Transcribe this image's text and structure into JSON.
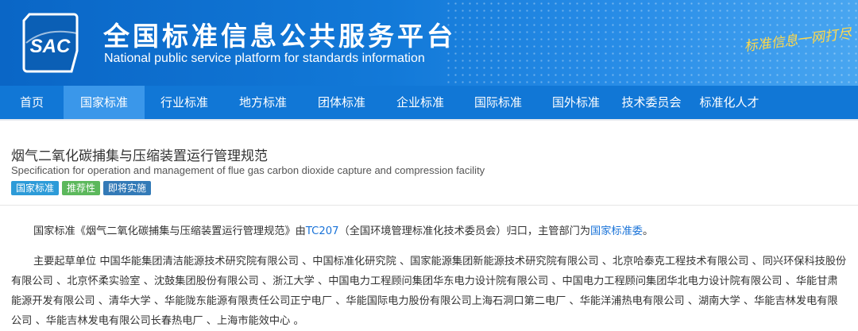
{
  "header": {
    "logo_text": "SAC",
    "title_cn": "全国标准信息公共服务平台",
    "title_en": "National public service platform  for standards information",
    "slogan": "标准信息一网打尽",
    "colors": {
      "primary": "#1177d6",
      "active": "#3a97ea",
      "slogan": "#ffd84a"
    }
  },
  "nav": {
    "items": [
      {
        "label": "首页"
      },
      {
        "label": "国家标准"
      },
      {
        "label": "行业标准"
      },
      {
        "label": "地方标准"
      },
      {
        "label": "团体标准"
      },
      {
        "label": "企业标准"
      },
      {
        "label": "国际标准"
      },
      {
        "label": "国外标准"
      },
      {
        "label": "技术委员会"
      },
      {
        "label": "标准化人才"
      }
    ],
    "active_index": 1
  },
  "standard": {
    "title_cn": "烟气二氧化碳捕集与压缩装置运行管理规范",
    "title_en": "Specification for operation and management of flue gas carbon dioxide capture and compression facility",
    "tags": [
      {
        "label": "国家标准",
        "color": "#2d9bd8"
      },
      {
        "label": "推荐性",
        "color": "#5cb85c"
      },
      {
        "label": "即将实施",
        "color": "#337ab7"
      }
    ]
  },
  "body": {
    "p1_a": "国家标准《烟气二氧化碳捕集与压缩装置运行管理规范》由",
    "p1_tc": "TC207",
    "p1_b": "（全国环境管理标准化技术委员会）归口，主管部门为",
    "p1_dept": "国家标准委",
    "p1_c": "。",
    "p2": "主要起草单位 中国华能集团清洁能源技术研究院有限公司 、中国标准化研究院 、国家能源集团新能源技术研究院有限公司 、北京哈泰克工程技术有限公司 、同兴环保科技股份有限公司 、北京怀柔实验室 、沈鼓集团股份有限公司 、浙江大学 、中国电力工程顾问集团华东电力设计院有限公司 、中国电力工程顾问集团华北电力设计院有限公司 、华能甘肃能源开发有限公司 、清华大学 、华能陇东能源有限责任公司正宁电厂 、华能国际电力股份有限公司上海石洞口第二电厂 、华能洋浦热电有限公司 、湖南大学 、华能吉林发电有限公司 、华能吉林发电有限公司长春热电厂 、上海市能效中心 。"
  }
}
